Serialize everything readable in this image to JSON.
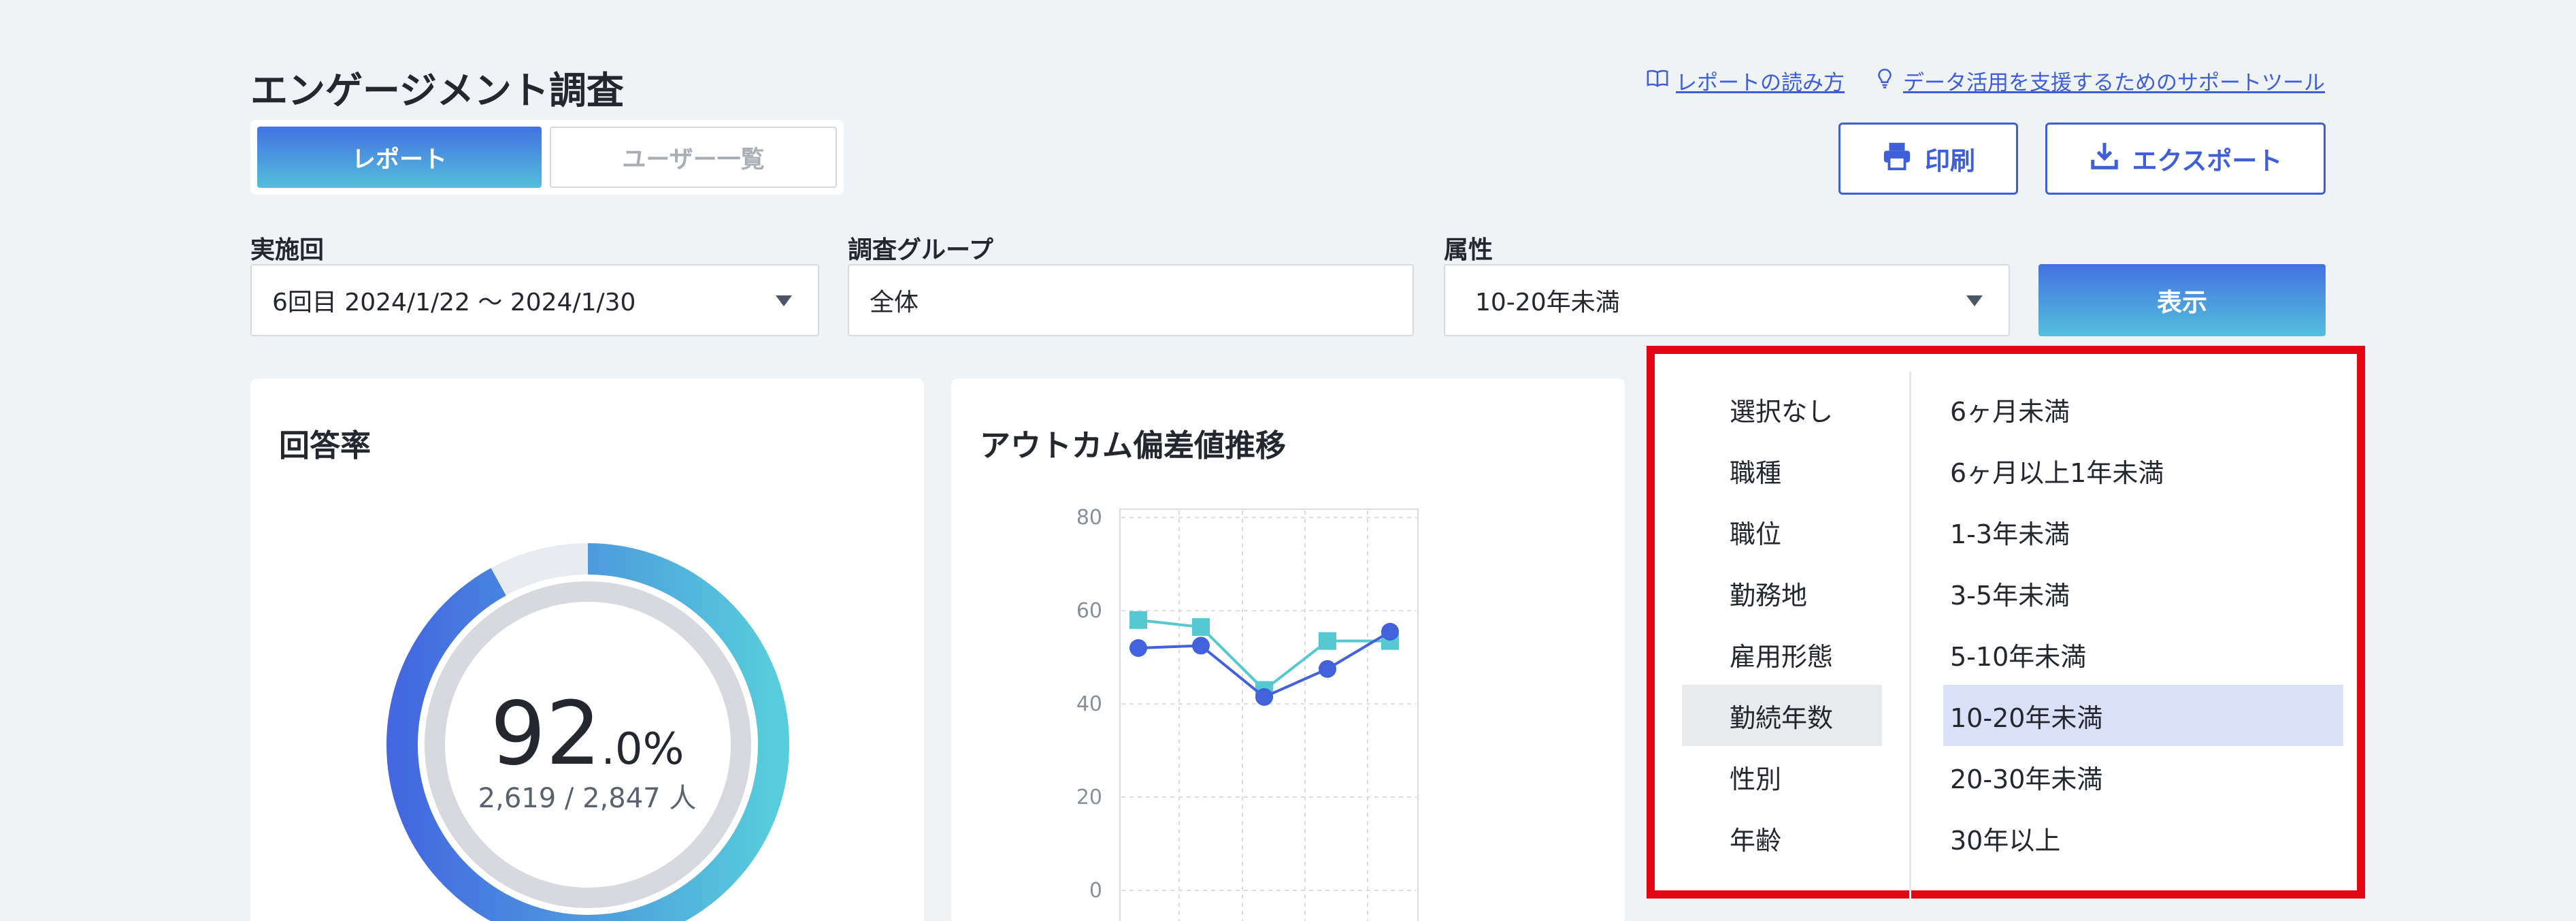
{
  "header": {
    "title": "エンゲージメント調査",
    "links": [
      {
        "icon": "book-icon",
        "label": "レポートの読み方"
      },
      {
        "icon": "lightbulb-icon",
        "label": "データ活用を支援するためのサポートツール"
      }
    ]
  },
  "tabs": [
    {
      "label": "レポート",
      "active": true
    },
    {
      "label": "ユーザー一覧",
      "active": false
    }
  ],
  "actions": {
    "print_label": "印刷",
    "export_label": "エクスポート"
  },
  "filters": {
    "round": {
      "label": "実施回",
      "value": "6回目  2024/1/22 〜 2024/1/30"
    },
    "group": {
      "label": "調査グループ",
      "value": "全体"
    },
    "attribute": {
      "label": "属性",
      "value": "10-20年未満"
    },
    "show_label": "表示"
  },
  "response_rate": {
    "title": "回答率",
    "percent_int": "92",
    "percent_dec": ".0%",
    "count": "2,619 / 2,847 人",
    "fraction": 0.92
  },
  "outcome": {
    "title": "アウトカム偏差値推移"
  },
  "chart_data": {
    "type": "line",
    "x": [
      1,
      2,
      3,
      4,
      5
    ],
    "ylim": [
      0,
      85
    ],
    "yticks": [
      "0",
      "20",
      "40",
      "60",
      "80"
    ],
    "grid": true,
    "series": [
      {
        "color": "#55c8d2",
        "marker": "square",
        "values": [
          58,
          56.5,
          43,
          53.5,
          53.5
        ]
      },
      {
        "color": "#4262db",
        "marker": "circle",
        "values": [
          52,
          52.5,
          41.5,
          47.5,
          55.5
        ]
      }
    ]
  },
  "attribute_menu": {
    "categories": [
      "選択なし",
      "職種",
      "職位",
      "勤務地",
      "雇用形態",
      "勤続年数",
      "性別",
      "年齢"
    ],
    "selected_category": 5,
    "options": [
      "6ヶ月未満",
      "6ヶ月以上1年未満",
      "1-3年未満",
      "3-5年未満",
      "5-10年未満",
      "10-20年未満",
      "20-30年未満",
      "30年以上"
    ],
    "selected_option": 5
  },
  "colors": {
    "accent": "#3f5fd8",
    "highlight_border": "#e30613",
    "gradient_top": "#4272e1",
    "gradient_bottom": "#55bfdc"
  }
}
